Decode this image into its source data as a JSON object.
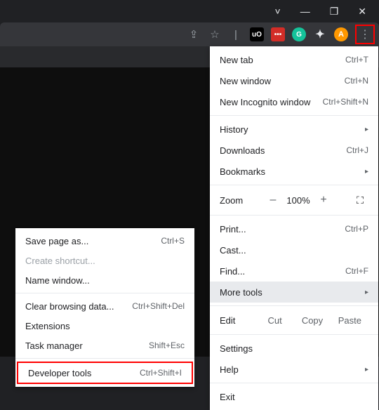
{
  "window_controls": {
    "chevron": "˅",
    "minimize": "—",
    "maximize": "❐",
    "close": "✕"
  },
  "toolbar": {
    "share": "⇪",
    "star": "☆",
    "sep": "|",
    "ext_uo": "uO",
    "ext_lp": "•••",
    "ext_gr": "G",
    "ext_pz": "✦",
    "avatar": "A",
    "dots": "⋮"
  },
  "menu": {
    "new_tab": {
      "label": "New tab",
      "shortcut": "Ctrl+T"
    },
    "new_window": {
      "label": "New window",
      "shortcut": "Ctrl+N"
    },
    "new_incognito": {
      "label": "New Incognito window",
      "shortcut": "Ctrl+Shift+N"
    },
    "history": {
      "label": "History"
    },
    "downloads": {
      "label": "Downloads",
      "shortcut": "Ctrl+J"
    },
    "bookmarks": {
      "label": "Bookmarks"
    },
    "zoom": {
      "label": "Zoom",
      "minus": "–",
      "value": "100%",
      "plus": "+",
      "fullscreen": "⛶"
    },
    "print": {
      "label": "Print...",
      "shortcut": "Ctrl+P"
    },
    "cast": {
      "label": "Cast..."
    },
    "find": {
      "label": "Find...",
      "shortcut": "Ctrl+F"
    },
    "more_tools": {
      "label": "More tools"
    },
    "edit": {
      "label": "Edit",
      "cut": "Cut",
      "copy": "Copy",
      "paste": "Paste"
    },
    "settings": {
      "label": "Settings"
    },
    "help": {
      "label": "Help"
    },
    "exit": {
      "label": "Exit"
    },
    "arrow": "▸"
  },
  "submenu": {
    "save_as": {
      "label": "Save page as...",
      "shortcut": "Ctrl+S"
    },
    "create_shortcut": {
      "label": "Create shortcut..."
    },
    "name_window": {
      "label": "Name window..."
    },
    "clear_data": {
      "label": "Clear browsing data...",
      "shortcut": "Ctrl+Shift+Del"
    },
    "extensions": {
      "label": "Extensions"
    },
    "task_manager": {
      "label": "Task manager",
      "shortcut": "Shift+Esc"
    },
    "dev_tools": {
      "label": "Developer tools",
      "shortcut": "Ctrl+Shift+I"
    }
  }
}
